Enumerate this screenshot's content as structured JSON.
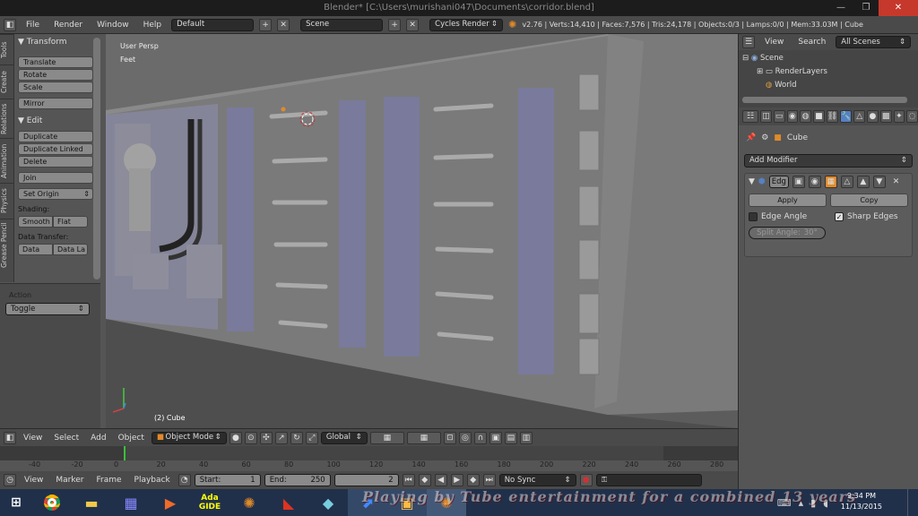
{
  "window": {
    "title": "Blender* [C:\\Users\\murishani047\\Documents\\corridor.blend]",
    "controls": [
      "—",
      "❐",
      "✕"
    ]
  },
  "info_header": {
    "menus": [
      "File",
      "Render",
      "Window",
      "Help"
    ],
    "layout": "Default",
    "scene": "Scene",
    "engine": "Cycles Render",
    "stats": "v2.76 | Verts:14,410 | Faces:7,576 | Tris:24,178 | Objects:0/3 | Lamps:0/0 | Mem:33.03M | Cube"
  },
  "tool_tabs": [
    "Tools",
    "Create",
    "Relations",
    "Animation",
    "Physics",
    "Grease Pencil"
  ],
  "tool_shelf": {
    "transform_title": "Transform",
    "transform_buttons": [
      "Translate",
      "Rotate",
      "Scale"
    ],
    "mirror": "Mirror",
    "edit_title": "Edit",
    "edit_buttons": [
      "Duplicate",
      "Duplicate Linked",
      "Delete"
    ],
    "join": "Join",
    "set_origin": "Set Origin",
    "shading_label": "Shading:",
    "smooth": "Smooth",
    "flat": "Flat",
    "data_transfer_label": "Data Transfer:",
    "data": "Data",
    "data_la": "Data La",
    "action_label": "Action",
    "action_value": "Toggle"
  },
  "viewport": {
    "view_name": "User Persp",
    "units": "Feet",
    "object_label": "(2) Cube"
  },
  "view3d_header": {
    "menus": [
      "View",
      "Select",
      "Add",
      "Object"
    ],
    "mode": "Object Mode",
    "orientation": "Global"
  },
  "timeline": {
    "ticks": [
      "-40",
      "-20",
      "0",
      "20",
      "40",
      "60",
      "80",
      "100",
      "120",
      "140",
      "160",
      "180",
      "200",
      "220",
      "240",
      "260",
      "280"
    ],
    "menus": [
      "View",
      "Marker",
      "Frame",
      "Playback"
    ],
    "start_label": "Start:",
    "start_value": "1",
    "end_label": "End:",
    "end_value": "250",
    "current_frame": "2",
    "sync": "No Sync",
    "current_frame_fraction": 0.029
  },
  "outliner": {
    "menus": [
      "View",
      "Search"
    ],
    "filter": "All Scenes",
    "items": [
      "Scene",
      "RenderLayers",
      "World"
    ]
  },
  "properties": {
    "object_name": "Cube",
    "add_modifier": "Add Modifier",
    "modifier_name": "Edg",
    "apply": "Apply",
    "copy": "Copy",
    "edge_angle": "Edge Angle",
    "sharp_edges": "Sharp Edges",
    "split_angle": "Split Angle:",
    "split_angle_value": "30°"
  },
  "taskbar": {
    "apps": [
      "chrome",
      "explorer",
      "app",
      "player",
      "Ada GIDE",
      "blender",
      "acrobat",
      "app",
      "app",
      "app",
      "blender"
    ],
    "ada_top": "Ada",
    "ada_bottom": "GIDE",
    "time": "9:34 PM",
    "date": "11/13/2015"
  },
  "watermark": "Playing by Tube entertainment for a combined 13 years",
  "colors": {
    "accent_blue": "#5680c2",
    "close_red": "#c7382c",
    "orange": "#e08a2a"
  }
}
